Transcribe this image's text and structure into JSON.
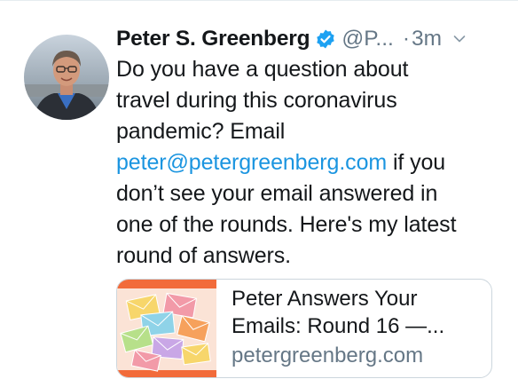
{
  "tweet": {
    "author": {
      "display_name": "Peter S. Greenberg",
      "handle": "@P...",
      "verified": true
    },
    "separator": "·",
    "time": "3m",
    "body": {
      "line1": "Do you have a question about",
      "line2": "travel during this coronavirus",
      "line3": "pandemic? Email",
      "line4_link": "peter@petergreenberg.com",
      "line4_rest": " if you",
      "line5": "don’t see your email answered in",
      "line6": "one of the rounds. Here's my latest",
      "line7": "round of answers."
    },
    "card": {
      "title_line1": "Peter Answers Your",
      "title_line2": "Emails: Round 16 —...",
      "domain": "petergreenberg.com"
    }
  },
  "colors": {
    "link": "#1b95e0",
    "secondary_text": "#657786",
    "verified_badge": "#1da1f2",
    "border": "#ccd6dd"
  },
  "icons": {
    "verified": "verified-badge-icon",
    "caret": "chevron-down-icon"
  }
}
